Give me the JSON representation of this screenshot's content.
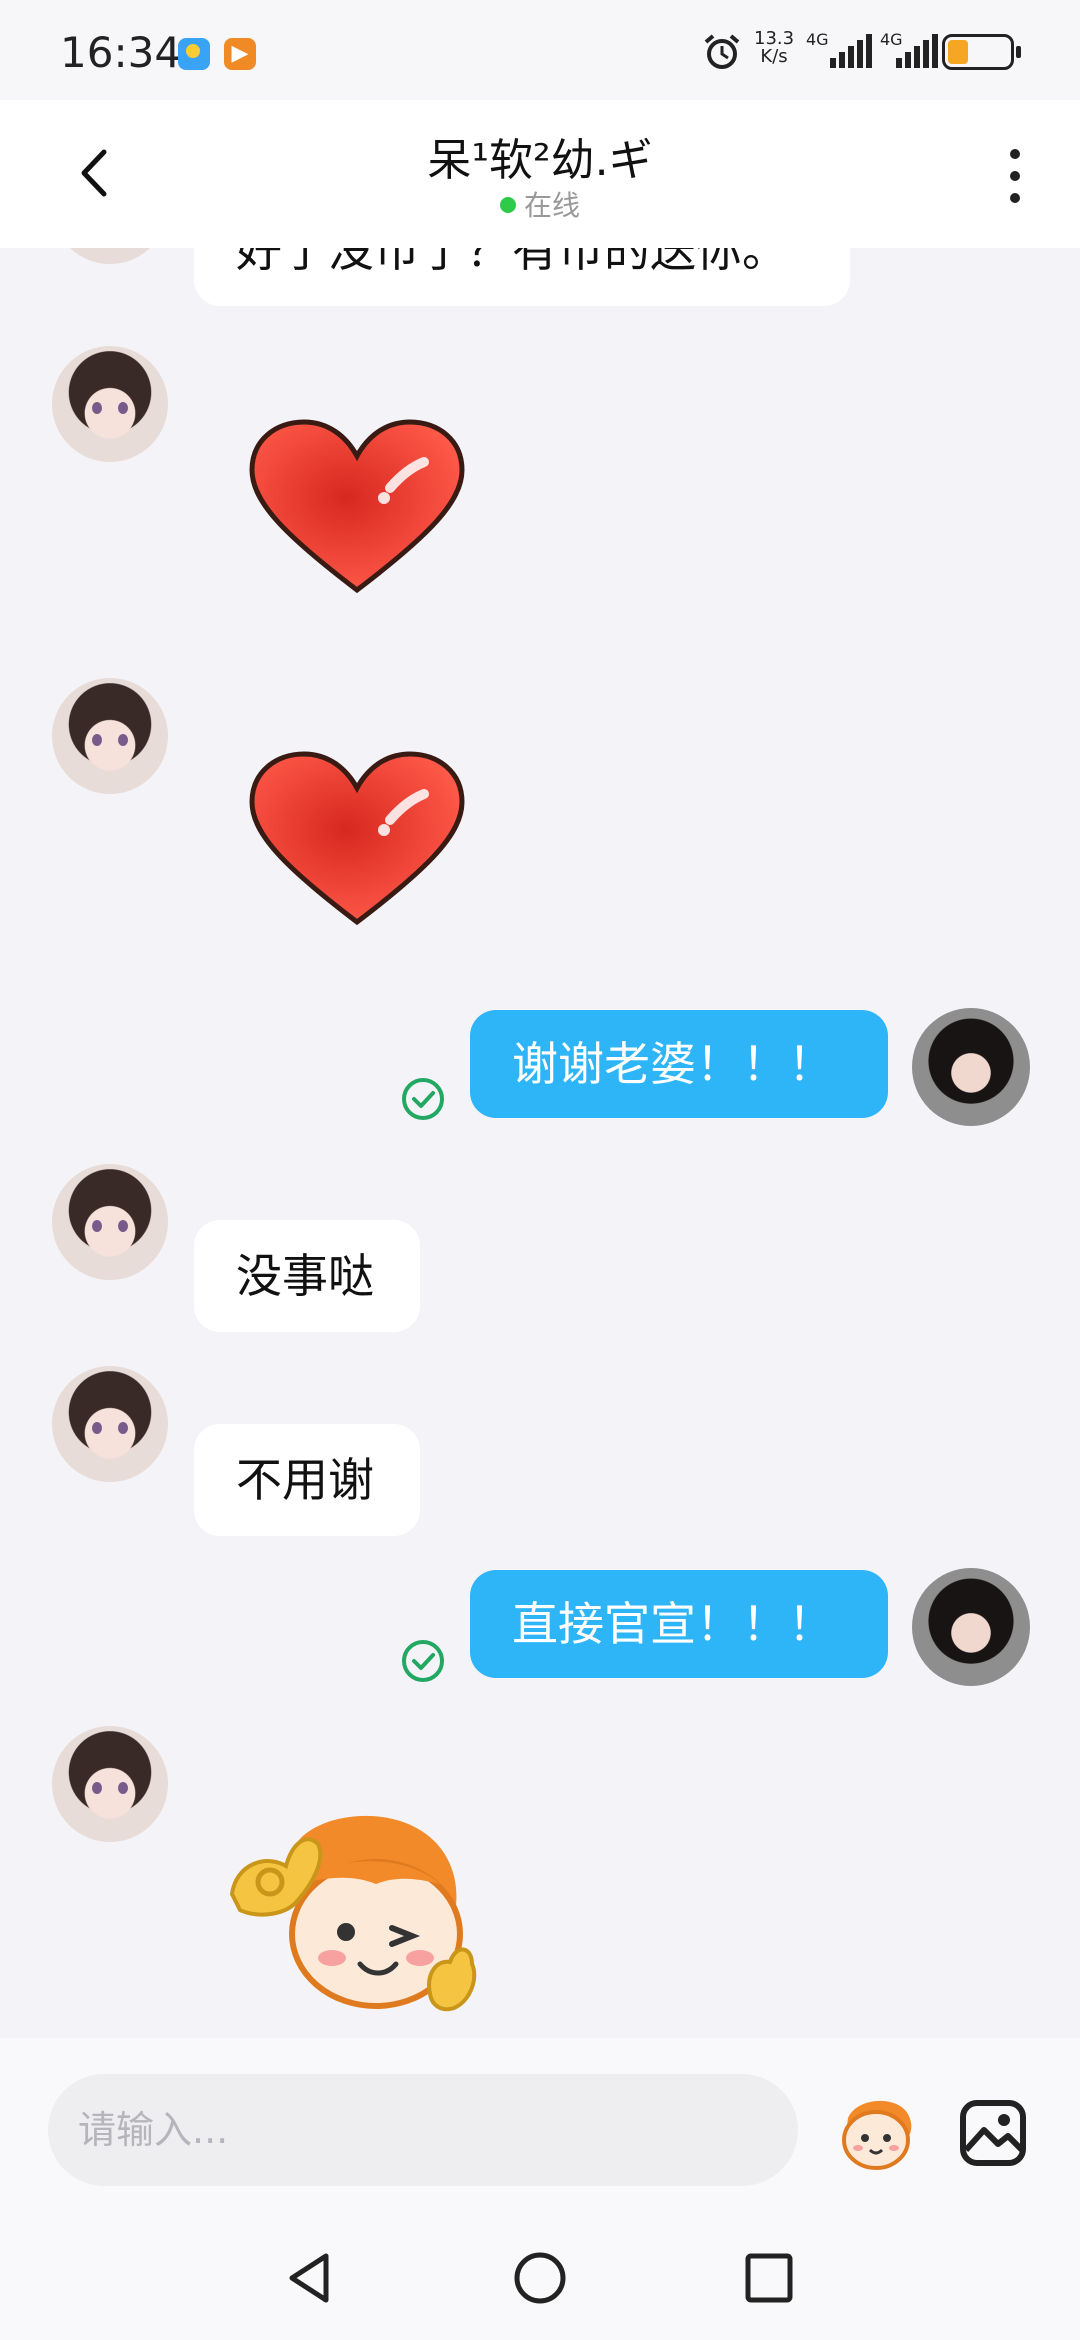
{
  "status_bar": {
    "time": "16:34",
    "speed_top": "13.3",
    "speed_bottom": "K/s",
    "network_1": "4G",
    "network_2": "4G",
    "battery_color": "#f5a623"
  },
  "header": {
    "back_icon": "chevron-left-icon",
    "title": "呆¹软²幼.ギ",
    "status": "在线",
    "status_color": "#2ecb4a",
    "more_icon": "more-vertical-icon"
  },
  "messages": [
    {
      "side": "left",
      "type": "text",
      "text": "好了没币了？有币的送你。"
    },
    {
      "side": "left",
      "type": "sticker",
      "sticker": "heart-sticker-icon"
    },
    {
      "side": "left",
      "type": "sticker",
      "sticker": "heart-sticker-icon"
    },
    {
      "side": "right",
      "type": "text",
      "text": "谢谢老婆！！！",
      "read_icon": "read-check-icon"
    },
    {
      "side": "left",
      "type": "text",
      "text": "没事哒"
    },
    {
      "side": "left",
      "type": "text",
      "text": "不用谢"
    },
    {
      "side": "right",
      "type": "text",
      "text": "直接官宣！！！",
      "read_icon": "read-check-icon"
    },
    {
      "side": "left",
      "type": "sticker",
      "sticker": "ok-gesture-mascot-sticker-icon"
    }
  ],
  "colors": {
    "outgoing_bubble": "#2eb5f8",
    "incoming_bubble": "#ffffff",
    "read_check": "#22a862",
    "background": "#f4f4f8"
  },
  "composer": {
    "placeholder": "请输入...",
    "emoji_icon": "mascot-emoji-icon",
    "image_icon": "image-icon"
  },
  "system_nav": {
    "back": "triangle-back-icon",
    "home": "circle-home-icon",
    "recents": "square-recents-icon"
  }
}
